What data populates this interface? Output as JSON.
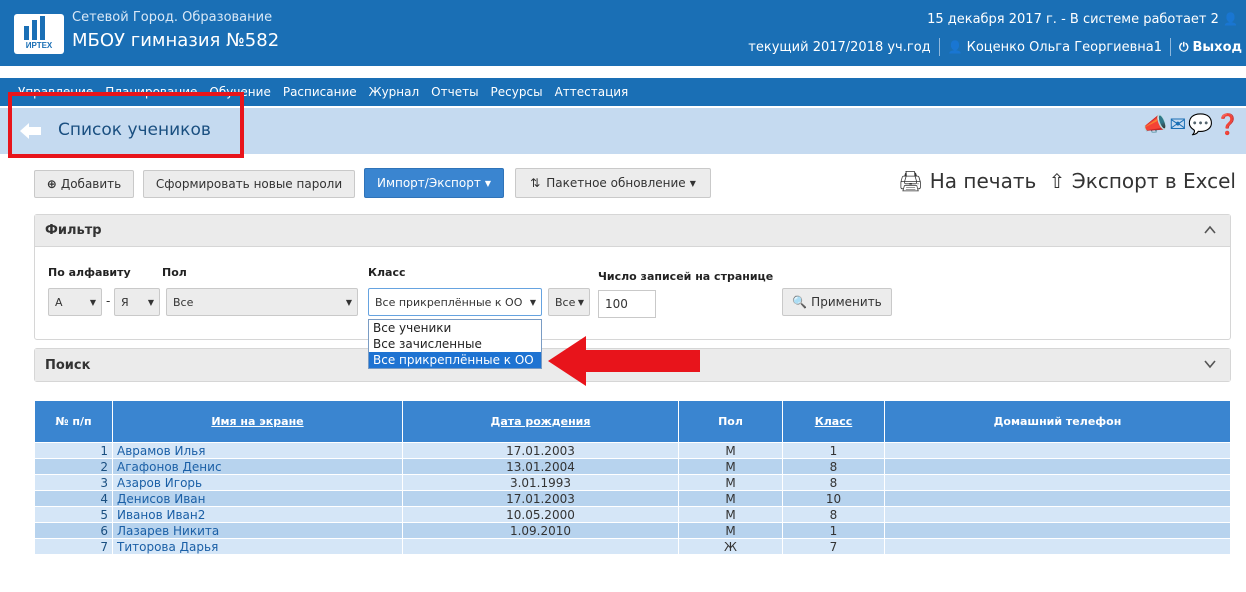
{
  "header": {
    "logo_text": "ИРТЕХ",
    "app_name": "Сетевой Город. Образование",
    "school": "МБОУ гимназия №582",
    "date_status": "15 декабря 2017 г. - В системе работает 2",
    "year": "текущий 2017/2018 уч.год",
    "user": "Коценко Ольга Георгиевна1",
    "logout": "Выход"
  },
  "nav": {
    "items": [
      "Управление",
      "Планирование",
      "Обучение",
      "Расписание",
      "Журнал",
      "Отчеты",
      "Ресурсы",
      "Аттестация"
    ]
  },
  "title": {
    "text": "Список учеников"
  },
  "toolbar": {
    "add": "Добавить",
    "new_passwords": "Сформировать новые пароли",
    "import_export": "Импорт/Экспорт",
    "batch_update": "Пакетное обновление",
    "print": "На печать",
    "excel": "Экспорт в Excel"
  },
  "filter": {
    "heading": "Фильтр",
    "alpha_label": "По алфавиту",
    "alpha_from": "А",
    "alpha_to": "Я",
    "gender_label": "Пол",
    "gender_value": "Все",
    "class_label": "Класс",
    "class_value": "Все прикреплённые к ОО",
    "class_sub_value": "Все",
    "per_page_label": "Число записей на странице",
    "per_page_value": "100",
    "apply": "Применить"
  },
  "class_dropdown": {
    "options": [
      "Все ученики",
      "Все зачисленные",
      "Все прикреплённые к ОО"
    ],
    "selected_index": 2
  },
  "search": {
    "heading": "Поиск"
  },
  "table": {
    "columns": [
      "№ п/п",
      "Имя на экране",
      "Дата рождения",
      "Пол",
      "Класс",
      "Домашний телефон"
    ],
    "rows": [
      {
        "n": "1",
        "name": "Аврамов Илья",
        "dob": "17.01.2003",
        "sex": "М",
        "cls": "1",
        "phone": ""
      },
      {
        "n": "2",
        "name": "Агафонов Денис",
        "dob": "13.01.2004",
        "sex": "М",
        "cls": "8",
        "phone": ""
      },
      {
        "n": "3",
        "name": "Азаров Игорь",
        "dob": "3.01.1993",
        "sex": "М",
        "cls": "8",
        "phone": ""
      },
      {
        "n": "4",
        "name": "Денисов Иван",
        "dob": "17.01.2003",
        "sex": "М",
        "cls": "10",
        "phone": ""
      },
      {
        "n": "5",
        "name": "Иванов Иван2",
        "dob": "10.05.2000",
        "sex": "М",
        "cls": "8",
        "phone": ""
      },
      {
        "n": "6",
        "name": "Лазарев Никита",
        "dob": "1.09.2010",
        "sex": "М",
        "cls": "1",
        "phone": ""
      },
      {
        "n": "7",
        "name": "Титорова Дарья",
        "dob": "",
        "sex": "Ж",
        "cls": "7",
        "phone": ""
      }
    ]
  },
  "colors": {
    "header_blue": "#1a6fb5",
    "title_bar": "#c5daf0",
    "table_header": "#3a85d0",
    "highlight_red": "#e8141b"
  }
}
